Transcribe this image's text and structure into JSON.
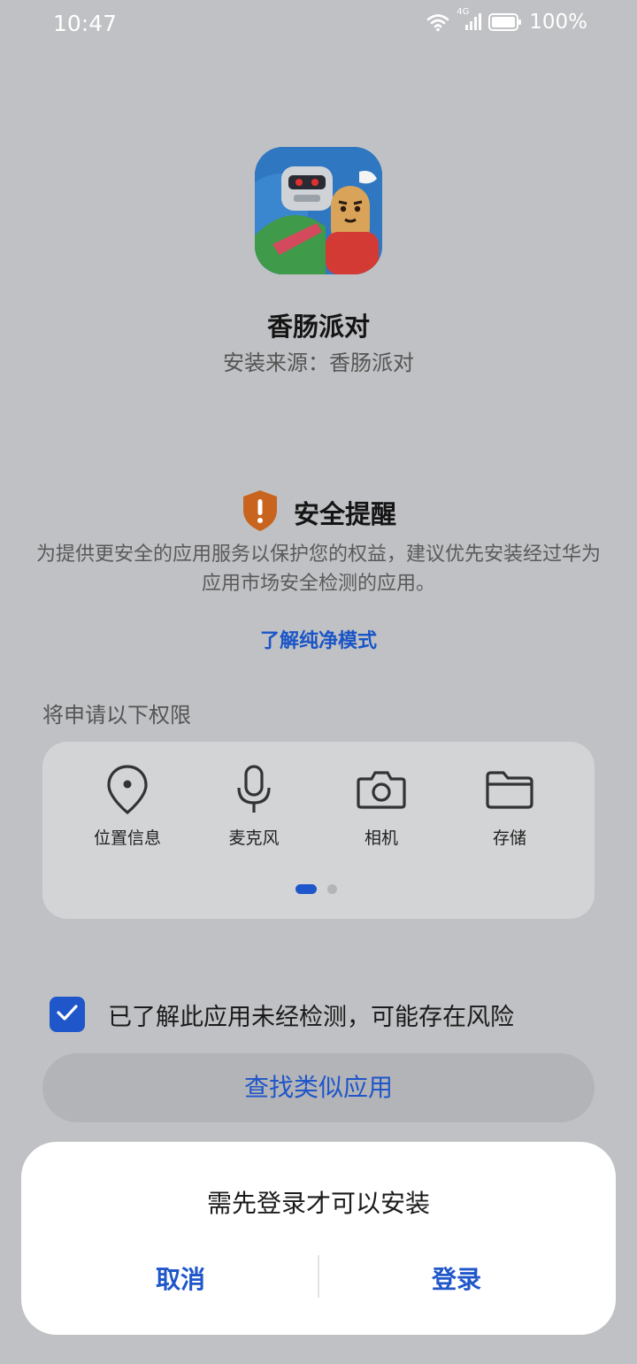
{
  "status_bar": {
    "time": "10:47",
    "network": "4G",
    "battery": "100%"
  },
  "app": {
    "name": "香肠派对",
    "source": "安装来源：香肠派对"
  },
  "security": {
    "title": "安全提醒",
    "description": "为提供更安全的应用服务以保护您的权益，建议优先安装经过华为应用市场安全检测的应用。",
    "link": "了解纯净模式",
    "accent_color": "#c8641e"
  },
  "permissions": {
    "heading": "将申请以下权限",
    "items": [
      {
        "label": "位置信息",
        "icon": "location-pin-icon"
      },
      {
        "label": "麦克风",
        "icon": "microphone-icon"
      },
      {
        "label": "相机",
        "icon": "camera-icon"
      },
      {
        "label": "存储",
        "icon": "folder-icon"
      }
    ],
    "page": 1,
    "page_count": 2
  },
  "acknowledge": {
    "label": "已了解此应用未经检测，可能存在风险",
    "checked": true
  },
  "find_similar": {
    "label": "查找类似应用"
  },
  "dialog": {
    "message": "需先登录才可以安装",
    "cancel": "取消",
    "login": "登录"
  },
  "colors": {
    "accent": "#1f56c9",
    "background": "#c0c1c4"
  }
}
